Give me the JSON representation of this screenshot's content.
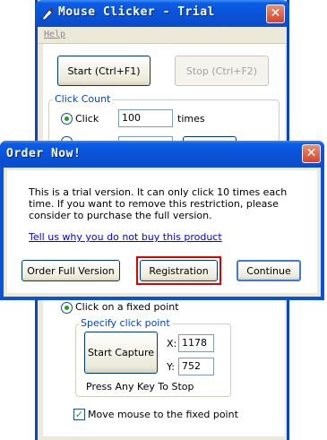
{
  "main_window": {
    "title": "Mouse Clicker - Trial",
    "menu": {
      "help": "Help"
    },
    "start_button": "Start (Ctrl+F1)",
    "stop_button": "Stop (Ctrl+F2)",
    "click_count": {
      "group_label": "Click Count",
      "option_click_label": "Click",
      "click_value": "100",
      "times_label": "times"
    },
    "position": {
      "fixed_point_label": "Click on a fixed point",
      "specify_group_label": "Specify click point",
      "start_capture_label": "Start Capture",
      "x_label": "X:",
      "x_value": "1178",
      "y_label": "Y:",
      "y_value": "752",
      "hint": "Press Any Key To Stop",
      "move_mouse_label": "Move mouse to the fixed point"
    }
  },
  "dialog": {
    "title": "Order Now!",
    "message": "This is a trial version. It can only click 10 times each time. If you want to remove this restriction, please consider to purchase the full version.",
    "link": "Tell us why you do not buy this product",
    "buttons": {
      "order": "Order Full Version",
      "registration": "Registration",
      "continue": "Continue"
    }
  },
  "colors": {
    "titlebar": "#0a52d6",
    "close_button": "#d0462a",
    "highlight": "#e00000",
    "link": "#0000ff"
  },
  "icons": {
    "app": "mouse-pen-icon",
    "close": "close-icon"
  }
}
